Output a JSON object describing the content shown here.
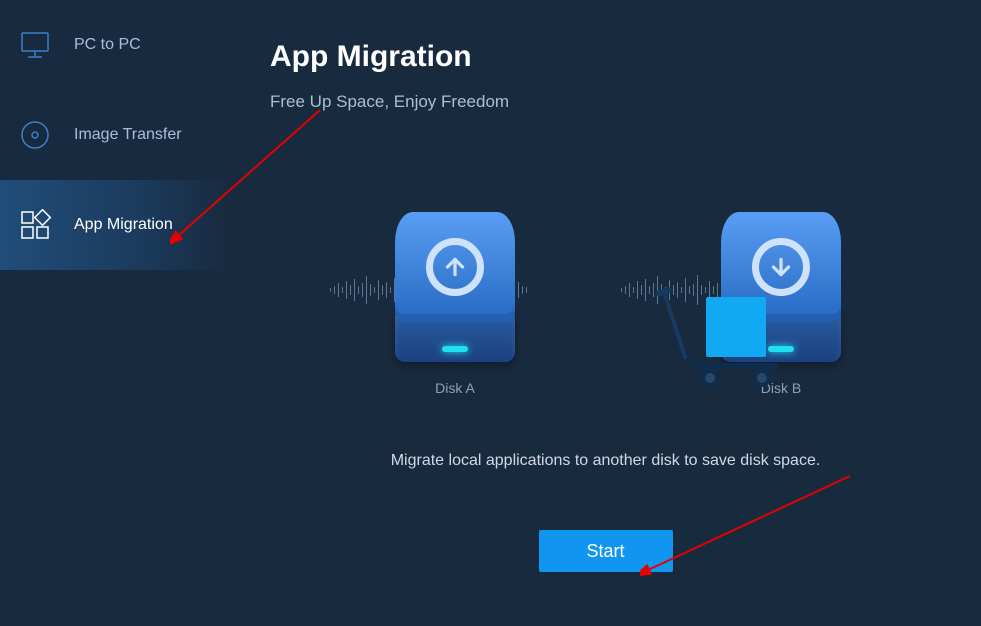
{
  "sidebar": {
    "items": [
      {
        "label": "PC to PC",
        "icon": "monitor-icon"
      },
      {
        "label": "Image Transfer",
        "icon": "disc-icon"
      },
      {
        "label": "App Migration",
        "icon": "apps-icon"
      }
    ],
    "active_index": 2
  },
  "main": {
    "title": "App Migration",
    "subtitle": "Free Up Space, Enjoy Freedom",
    "disk_a_label": "Disk A",
    "disk_b_label": "Disk B",
    "description": "Migrate local applications to another disk to save disk space.",
    "start_label": "Start"
  },
  "colors": {
    "accent": "#1196f0",
    "sidebar_bg": "#172a3f",
    "main_bg": "#182a3e",
    "text_muted": "#a8bfd6"
  }
}
